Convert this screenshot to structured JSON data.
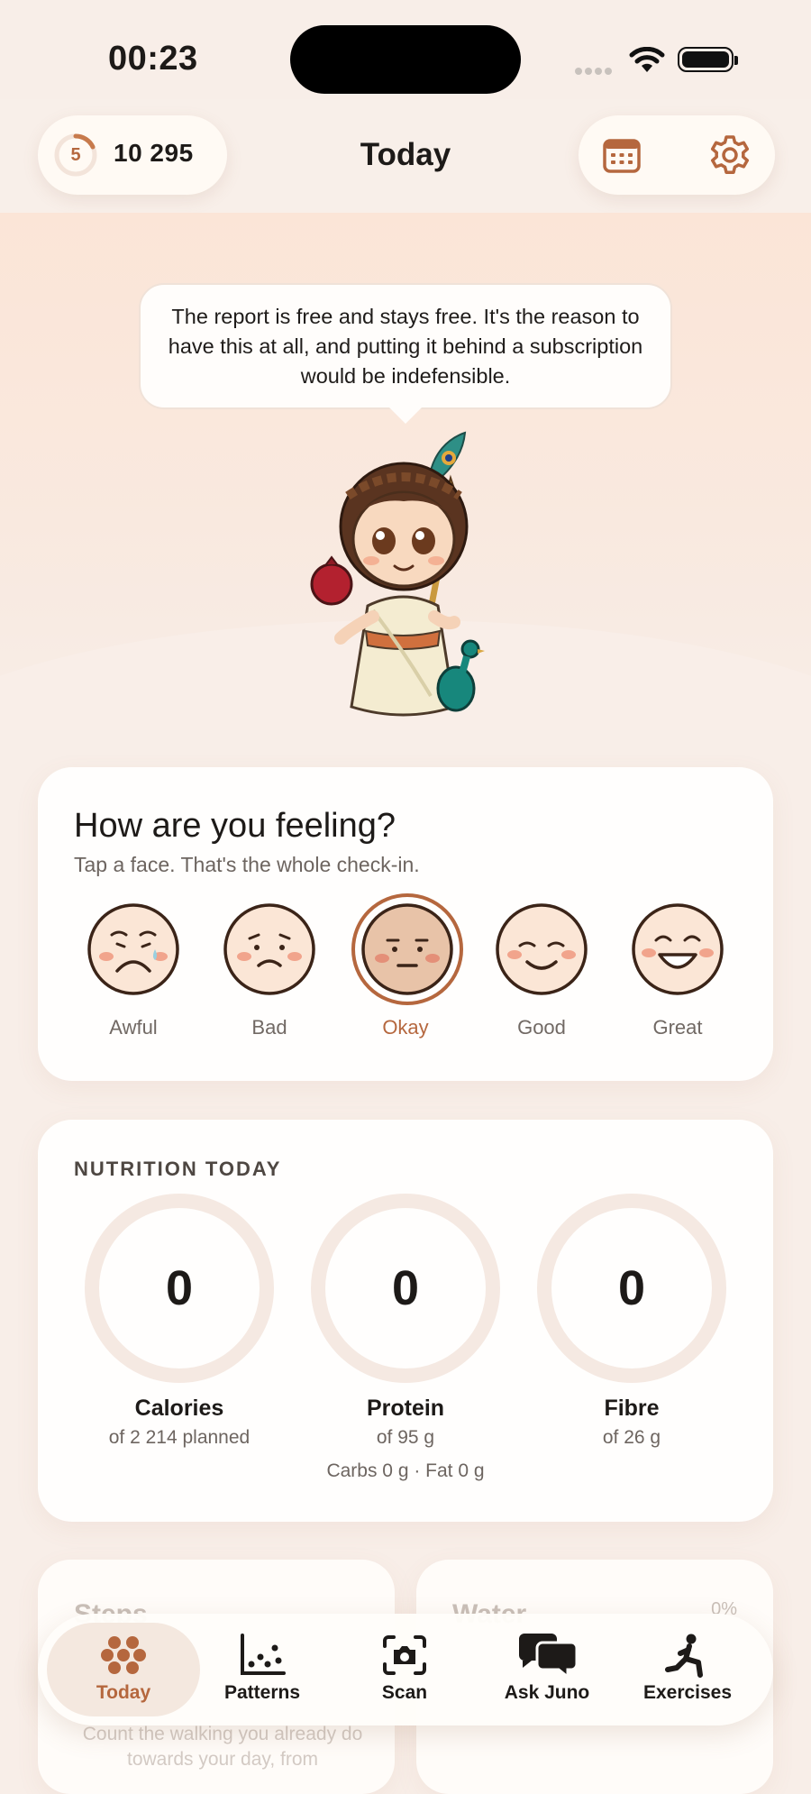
{
  "status_bar": {
    "time": "00:23"
  },
  "header": {
    "streak_count": "5",
    "points": "10 295",
    "title": "Today"
  },
  "hero": {
    "speech": "The report is free and stays free. It's the reason to have this at all, and putting it behind a subscription would be indefensible."
  },
  "mood": {
    "title": "How are you feeling?",
    "subtitle": "Tap a face. That's the whole check-in.",
    "options": [
      {
        "label": "Awful"
      },
      {
        "label": "Bad"
      },
      {
        "label": "Okay"
      },
      {
        "label": "Good"
      },
      {
        "label": "Great"
      }
    ],
    "selected": "Okay"
  },
  "nutrition": {
    "heading": "NUTRITION TODAY",
    "gauges": [
      {
        "value": "0",
        "name": "Calories",
        "target": "of 2 214 planned"
      },
      {
        "value": "0",
        "name": "Protein",
        "target": "of 95 g"
      },
      {
        "value": "0",
        "name": "Fibre",
        "target": "of 26 g"
      }
    ],
    "macros": "Carbs 0 g · Fat 0 g"
  },
  "peek": {
    "steps_title": "Steps",
    "steps_text": "Count the walking you already do towards your day, from",
    "water_title": "Water",
    "water_pct": "0%"
  },
  "tabs": [
    {
      "label": "Today",
      "icon": "dots-flower-icon"
    },
    {
      "label": "Patterns",
      "icon": "scatter-chart-icon"
    },
    {
      "label": "Scan",
      "icon": "camera-scan-icon"
    },
    {
      "label": "Ask Juno",
      "icon": "chat-bubbles-icon"
    },
    {
      "label": "Exercises",
      "icon": "lunge-figure-icon"
    }
  ],
  "colors": {
    "accent": "#b5673e",
    "background": "#f8eee8",
    "card": "#fffefd",
    "ring_track": "#f5e9e2"
  }
}
